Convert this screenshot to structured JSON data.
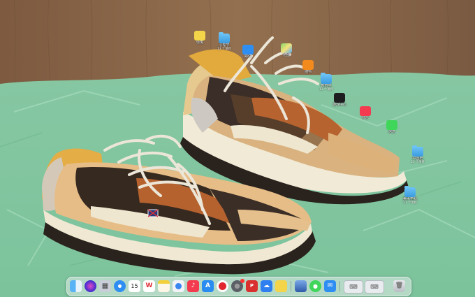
{
  "desktop_icons": [
    {
      "label": "便笺",
      "sub": ""
    },
    {
      "label": "心理学",
      "sub": "13 个项目"
    },
    {
      "label": "邮件",
      "sub": ""
    },
    {
      "label": "地图",
      "sub": ""
    },
    {
      "label": "图书",
      "sub": ""
    },
    {
      "label": "教育学",
      "sub": "13 个项目"
    },
    {
      "label": "游戏中心",
      "sub": ""
    },
    {
      "label": "音乐",
      "sub": ""
    },
    {
      "label": "信息",
      "sub": ""
    },
    {
      "label": "中国史",
      "sub": "23 个项目"
    },
    {
      "label": "美术学科",
      "sub": "11 个项目"
    }
  ],
  "dock": {
    "calendar_day": "15",
    "wps_letter": "W",
    "items": [
      "Finder",
      "Siri",
      "启动台",
      "Safari",
      "日历",
      "WPS Office",
      "备忘录",
      "无边记",
      "音乐",
      "App Store",
      "网易云音乐",
      "系统设置",
      "PDF",
      "百度网盘",
      "便笺",
      "预览",
      "信息",
      "邮件",
      "键盘查看器",
      "废纸篓"
    ]
  },
  "colors": {
    "folder": "#4aa8ea",
    "dock_bg": "#e1ebe8",
    "wall": "#8d6548",
    "paper": "#84c9a3"
  }
}
